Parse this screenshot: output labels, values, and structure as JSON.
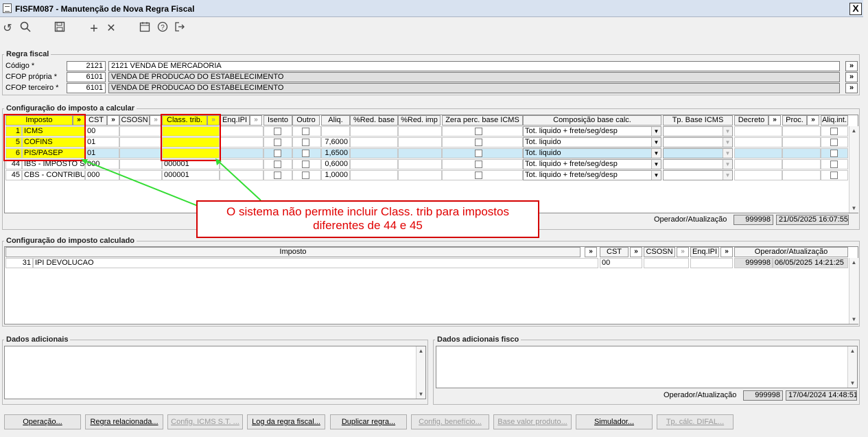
{
  "window": {
    "title": "FISFM087 - Manutenção de Nova Regra Fiscal",
    "close": "X"
  },
  "toolbar": {
    "refresh": "↺",
    "search": "🔍",
    "save": "💾",
    "add": "+",
    "remove": "✕",
    "calendar": "📅",
    "help": "?",
    "exit": "↦"
  },
  "regra": {
    "group_label": "Regra fiscal",
    "codigo_label": "Código *",
    "codigo_value": "2121",
    "codigo_desc": "2121 VENDA DE MERCADORIA",
    "cfop_propria_label": "CFOP própria *",
    "cfop_propria_value": "6101",
    "cfop_propria_desc": "VENDA DE PRODUCAO DO ESTABELECIMENTO",
    "cfop_terceiro_label": "CFOP terceiro *",
    "cfop_terceiro_value": "6101",
    "cfop_terceiro_desc": "VENDA DE PRODUCAO DO ESTABELECIMENTO",
    "more": "»"
  },
  "calc": {
    "group_label": "Configuração do imposto a calcular",
    "headers": {
      "imposto": "Imposto",
      "cst": "CST",
      "csosn": "CSOSN",
      "class_trib": "Class. trib.",
      "enq_ipi": "Enq.IPI",
      "isento": "Isento",
      "outro": "Outro",
      "aliq": "Aliq.",
      "red_base": "%Red. base",
      "red_imp": "%Red. imp",
      "zera": "Zera perc. base ICMS",
      "composicao": "Composição base calc.",
      "tp_base": "Tp. Base ICMS",
      "decreto": "Decreto",
      "proc": "Proc.",
      "aliq_int": "Aliq.int."
    },
    "rows": [
      {
        "cod": "1",
        "nome": "ICMS",
        "cst": "00",
        "csosn": "",
        "class": "",
        "aliq": "",
        "comp": "Tot. liquido + frete/seg/desp"
      },
      {
        "cod": "5",
        "nome": "COFINS",
        "cst": "01",
        "csosn": "",
        "class": "",
        "aliq": "7,6000",
        "comp": "Tot. liquido"
      },
      {
        "cod": "6",
        "nome": "PIS/PASEP",
        "cst": "01",
        "csosn": "",
        "class": "",
        "aliq": "1,6500",
        "comp": "Tot. liquido"
      },
      {
        "cod": "44",
        "nome": "IBS - IMPOSTO SOBRE",
        "cst": "000",
        "csosn": "",
        "class": "000001",
        "aliq": "0,6000",
        "comp": "Tot. liquido + frete/seg/desp"
      },
      {
        "cod": "45",
        "nome": "CBS - CONTRIBUIÇÃO",
        "cst": "000",
        "csosn": "",
        "class": "000001",
        "aliq": "1,0000",
        "comp": "Tot. liquido + frete/seg/desp"
      }
    ],
    "operador_label": "Operador/Atualização",
    "operador": "999998",
    "atualizacao": "21/05/2025 16:07:55"
  },
  "callout": {
    "line1": "O sistema não permite incluir Class. trib para impostos",
    "line2": "diferentes de 44 e 45"
  },
  "calculado": {
    "group_label": "Configuração do imposto calculado",
    "headers": {
      "imposto": "Imposto",
      "cst": "CST",
      "csosn": "CSOSN",
      "enq_ipi": "Enq.IPI",
      "operador": "Operador/Atualização"
    },
    "row": {
      "cod": "31",
      "nome": "IPI DEVOLUCAO",
      "cst": "00",
      "operador": "999998",
      "data": "06/05/2025 14:21:25"
    }
  },
  "adicionais": {
    "label": "Dados adicionais",
    "fisco_label": "Dados adicionais fisco",
    "operador_label": "Operador/Atualização",
    "operador": "999998",
    "data": "17/04/2024 14:48:51"
  },
  "buttons": {
    "operacao": "Operação...",
    "regra_rel": "Regra relacionada...",
    "config_icms": "Config. ICMS S.T. ...",
    "log": "Log da regra fiscal...",
    "duplicar": "Duplicar regra...",
    "config_benef": "Config. benefício...",
    "base_valor": "Base valor produto...",
    "simulador": "Simulador...",
    "tp_calc": "Tp. cálc. DIFAL..."
  }
}
